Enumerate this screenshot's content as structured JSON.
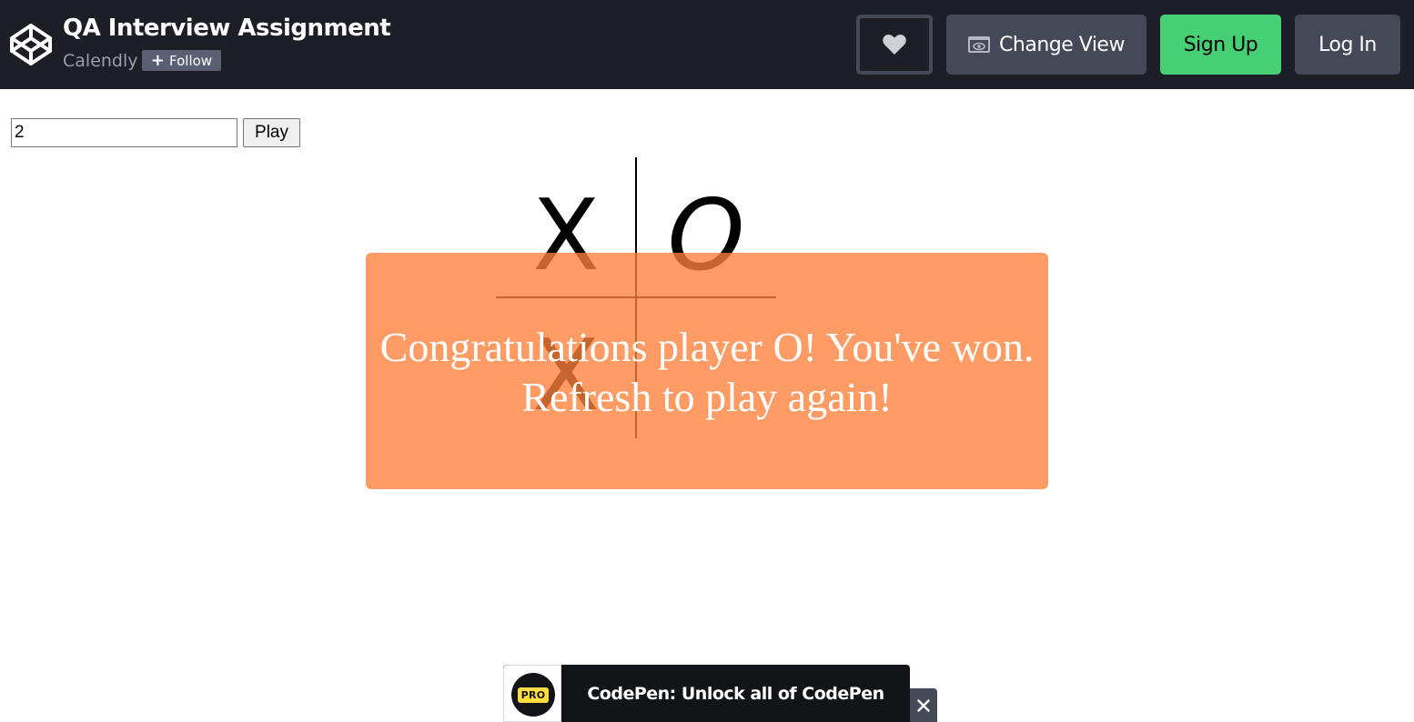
{
  "header": {
    "title": "QA Interview Assignment",
    "author": "Calendly",
    "follow_label": "Follow",
    "follow_plus": "+",
    "change_view_label": "Change View",
    "sign_up_label": "Sign Up",
    "log_in_label": "Log In",
    "icons": [
      "codepen-logo-icon",
      "heart-icon",
      "eye-icon",
      "plus-icon"
    ]
  },
  "controls": {
    "size_value": "2",
    "play_label": "Play"
  },
  "board": {
    "size": 2,
    "cells": [
      "X",
      "O",
      "X",
      ""
    ]
  },
  "result": {
    "line1": "Congratulations player O! You've won.",
    "line2": "Refresh to play again!"
  },
  "pro_banner": {
    "badge": "PRO",
    "text": "CodePen: Unlock all of CodePen",
    "close": "✕"
  },
  "colors": {
    "header_bg": "#1e1f26",
    "button_gray": "#444857",
    "sign_up_green": "#47cf73",
    "overlay_orange": "#ff803a",
    "pro_yellow": "#ffdd40"
  }
}
